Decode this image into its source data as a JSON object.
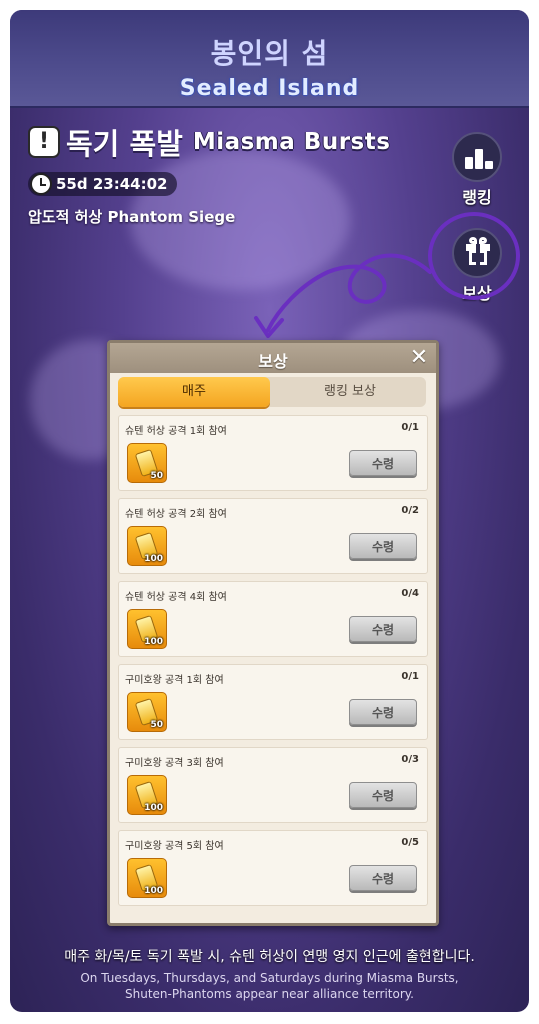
{
  "header": {
    "title_ko": "봉인의 섬",
    "title_en": "Sealed Island"
  },
  "event": {
    "alert_glyph": "!",
    "title_ko": "독기 폭발",
    "title_en": "Miasma Bursts",
    "timer": "55d 23:44:02",
    "subtitle": "압도적 허상 Phantom Siege"
  },
  "side": {
    "ranking_label": "랭킹",
    "reward_label": "보상"
  },
  "panel": {
    "title": "보상",
    "close_glyph": "✕",
    "tabs": [
      "매주",
      "랭킹 보상"
    ],
    "tasks": [
      {
        "label": "슈텐 허상 공격 1회 참여",
        "progress": "0/1",
        "reward_qty": "50",
        "button": "수령"
      },
      {
        "label": "슈텐 허상 공격 2회 참여",
        "progress": "0/2",
        "reward_qty": "100",
        "button": "수령"
      },
      {
        "label": "슈텐 허상 공격 4회 참여",
        "progress": "0/4",
        "reward_qty": "100",
        "button": "수령"
      },
      {
        "label": "구미호왕 공격 1회 참여",
        "progress": "0/1",
        "reward_qty": "50",
        "button": "수령"
      },
      {
        "label": "구미호왕 공격 3회 참여",
        "progress": "0/3",
        "reward_qty": "100",
        "button": "수령"
      },
      {
        "label": "구미호왕 공격 5회 참여",
        "progress": "0/5",
        "reward_qty": "100",
        "button": "수령"
      }
    ]
  },
  "footer": {
    "ko": "매주 화/목/토 독기 폭발 시, 슈텐 허상이 연맹 영지 인근에 출현합니다.",
    "en_line1": "On Tuesdays, Thursdays, and Saturdays during Miasma Bursts,",
    "en_line2": "Shuten-Phantoms appear near alliance territory."
  },
  "colors": {
    "annotation": "#6a2fc0",
    "tab_active": "#f4a521",
    "background": "#54408e"
  },
  "icons": [
    "alert-icon",
    "clock-icon",
    "ranking-icon",
    "gift-icon",
    "close-icon",
    "coin-icon"
  ]
}
